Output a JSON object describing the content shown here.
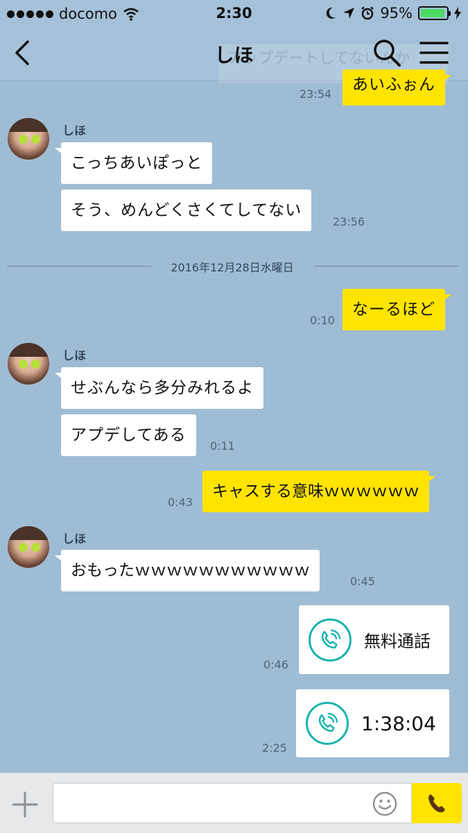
{
  "status_bar": {
    "carrier": "docomo",
    "time": "2:30",
    "battery_percent": "95%",
    "battery_level": 0.95
  },
  "header": {
    "title": "しほ",
    "ghost_text": "アップデートしてないんか"
  },
  "messages": {
    "m0": {
      "text": "あいふぉん",
      "time": "23:54"
    },
    "g1": {
      "sender": "しほ",
      "m1": "こっちあいぽっと",
      "m2": "そう、めんどくさくてしてない",
      "time": "23:56"
    },
    "date_separator": "2016年12月28日水曜日",
    "m3": {
      "text": "なーるほど",
      "time": "0:10"
    },
    "g2": {
      "sender": "しほ",
      "m1": "せぶんなら多分みれるよ",
      "m2": "アプデしてある",
      "time": "0:11"
    },
    "m4": {
      "text": "キャスする意味ｗｗｗｗｗｗ",
      "time": "0:43"
    },
    "g3": {
      "sender": "しほ",
      "m1": "おもったｗｗｗｗｗｗｗｗｗｗｗ",
      "time": "0:45"
    },
    "call1": {
      "label": "無料通話",
      "time": "0:46"
    },
    "call2": {
      "label": "1:38:04",
      "time": "2:25"
    }
  },
  "icons": {
    "back": "chevron-left-icon",
    "search": "search-icon",
    "menu": "hamburger-menu-icon",
    "plus": "plus-icon",
    "emoji": "smiley-icon",
    "call": "phone-icon"
  },
  "colors": {
    "background": "#9fbcd5",
    "outgoing_bubble": "#ffe400",
    "incoming_bubble": "#ffffff",
    "call_accent": "#17b3ad"
  },
  "input": {
    "value": "",
    "placeholder": ""
  }
}
